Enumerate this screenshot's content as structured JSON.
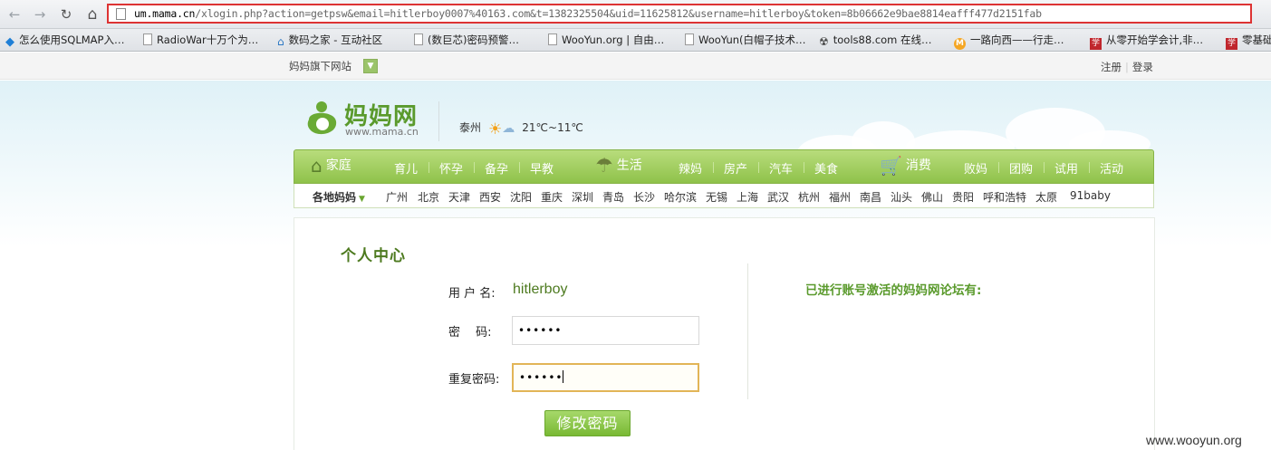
{
  "browser": {
    "url_host": "um.mama.cn",
    "url_path": "/xlogin.php?action=getpsw&email=hitlerboy0007%40163.com&t=1382325504&uid=11625812&username=hitlerboy&token=8b06662e9bae8814eafff477d2151fab",
    "back_glyph": "←",
    "forward_glyph": "→",
    "reload_glyph": "↻",
    "home_glyph": "⌂",
    "bookmarks": [
      {
        "label": "怎么使用SQLMAP入…",
        "icon": "diamond-icon"
      },
      {
        "label": "RadioWar十万个为…",
        "icon": "page-icon"
      },
      {
        "label": "数码之家 - 互动社区",
        "icon": "house-icon"
      },
      {
        "label": "(数巨芯)密码预警…",
        "icon": "page-icon"
      },
      {
        "label": "WooYun.org | 自由…",
        "icon": "page-icon"
      },
      {
        "label": "WooYun(白帽子技术…",
        "icon": "page-icon"
      },
      {
        "label": "tools88.com 在线…",
        "icon": "radiation-icon"
      },
      {
        "label": "一路向西——行走…",
        "icon": "m-circle-icon"
      },
      {
        "label": "从零开始学会计,非…",
        "icon": "study-icon"
      },
      {
        "label": "零基础",
        "icon": "study-icon"
      }
    ]
  },
  "site_top": {
    "network_link": "妈妈旗下网站",
    "register": "注册",
    "login": "登录"
  },
  "header": {
    "logo_title": "妈妈网",
    "logo_sub": "www.mama.cn",
    "weather_city": "泰州",
    "weather_temp": "21℃~11℃"
  },
  "nav": {
    "home": "家庭",
    "life": "生活",
    "consume": "消费",
    "items_a": [
      "育儿",
      "怀孕",
      "备孕",
      "早教"
    ],
    "items_b": [
      "辣妈",
      "房产",
      "汽车",
      "美食"
    ],
    "items_c": [
      "败妈",
      "团购",
      "试用",
      "活动"
    ]
  },
  "subnav": {
    "label": "各地妈妈",
    "cities": [
      "广州",
      "北京",
      "天津",
      "西安",
      "沈阳",
      "重庆",
      "深圳",
      "青岛",
      "长沙",
      "哈尔滨",
      "无锡",
      "上海",
      "武汉",
      "杭州",
      "福州",
      "南昌",
      "汕头",
      "佛山",
      "贵阳",
      "呼和浩特",
      "太原",
      "91baby"
    ]
  },
  "panel": {
    "title": "个人中心",
    "username_label": "用 户 名:",
    "username_value": "hitlerboy",
    "password_label": "密　 码:",
    "password_value": "••••••",
    "confirm_label": "重复密码:",
    "confirm_value": "••••••",
    "submit": "修改密码",
    "forums_title": "已进行账号激活的妈妈网论坛有:"
  },
  "watermark": "www.wooyun.org"
}
